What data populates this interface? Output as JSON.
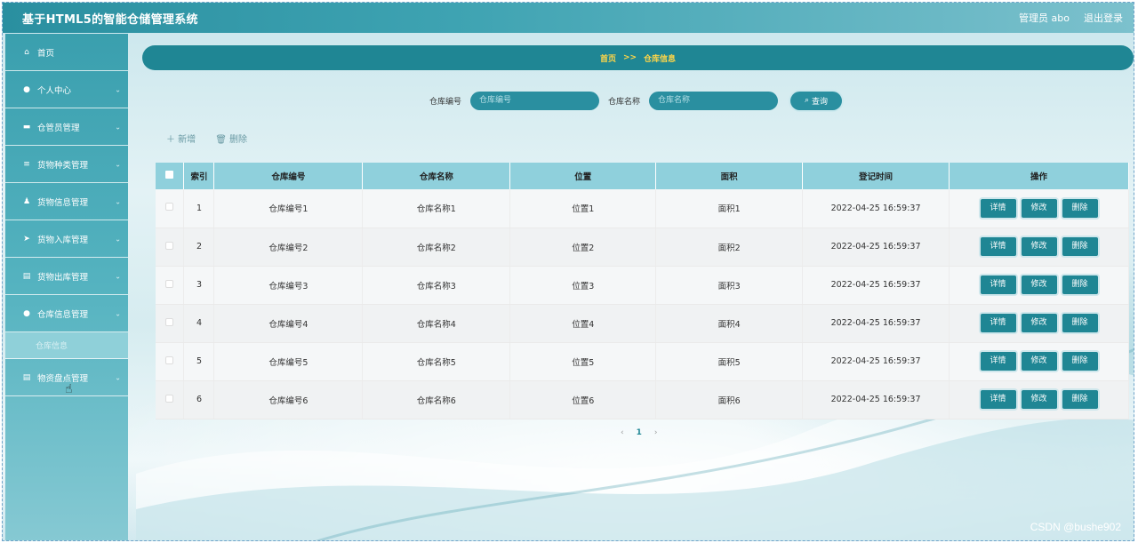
{
  "app": {
    "title": "基于HTML5的智能仓储管理系统",
    "user": "管理员 abo",
    "logout": "退出登录"
  },
  "sidebar": {
    "items": [
      {
        "label": "首页",
        "icon": "home-icon",
        "glyph": "⌂"
      },
      {
        "label": "个人中心",
        "icon": "user-icon",
        "glyph": "●"
      },
      {
        "label": "仓管员管理",
        "icon": "bag-icon",
        "glyph": "▬"
      },
      {
        "label": "货物种类管理",
        "icon": "sliders-icon",
        "glyph": "≡"
      },
      {
        "label": "货物信息管理",
        "icon": "person-icon",
        "glyph": "♟"
      },
      {
        "label": "货物入库管理",
        "icon": "send-icon",
        "glyph": "➤"
      },
      {
        "label": "货物出库管理",
        "icon": "doc-icon",
        "glyph": "▤"
      },
      {
        "label": "仓库信息管理",
        "icon": "user-icon",
        "glyph": "●"
      },
      {
        "label": "物资盘点管理",
        "icon": "clipboard-icon",
        "glyph": "▤"
      }
    ],
    "sub_item": "仓库信息"
  },
  "breadcrumb": {
    "home": "首页",
    "sep": ">>",
    "current": "仓库信息"
  },
  "search": {
    "label1": "仓库编号",
    "placeholder1": "仓库编号",
    "label2": "仓库名称",
    "placeholder2": "仓库名称",
    "button": "查询"
  },
  "actions": {
    "add": "＋ 新增",
    "delete": "🗑 删除"
  },
  "table": {
    "headers": [
      "索引",
      "仓库编号",
      "仓库名称",
      "位置",
      "面积",
      "登记时间",
      "操作"
    ],
    "rows": [
      {
        "idx": "1",
        "code": "仓库编号1",
        "name": "仓库名称1",
        "loc": "位置1",
        "area": "面积1",
        "time": "2022-04-25 16:59:37"
      },
      {
        "idx": "2",
        "code": "仓库编号2",
        "name": "仓库名称2",
        "loc": "位置2",
        "area": "面积2",
        "time": "2022-04-25 16:59:37"
      },
      {
        "idx": "3",
        "code": "仓库编号3",
        "name": "仓库名称3",
        "loc": "位置3",
        "area": "面积3",
        "time": "2022-04-25 16:59:37"
      },
      {
        "idx": "4",
        "code": "仓库编号4",
        "name": "仓库名称4",
        "loc": "位置4",
        "area": "面积4",
        "time": "2022-04-25 16:59:37"
      },
      {
        "idx": "5",
        "code": "仓库编号5",
        "name": "仓库名称5",
        "loc": "位置5",
        "area": "面积5",
        "time": "2022-04-25 16:59:37"
      },
      {
        "idx": "6",
        "code": "仓库编号6",
        "name": "仓库名称6",
        "loc": "位置6",
        "area": "面积6",
        "time": "2022-04-25 16:59:37"
      }
    ],
    "op_detail": "详情",
    "op_edit": "修改",
    "op_delete": "删除"
  },
  "pager": {
    "prev": "‹",
    "current": "1",
    "next": "›"
  },
  "watermark": "CSDN @bushe902"
}
